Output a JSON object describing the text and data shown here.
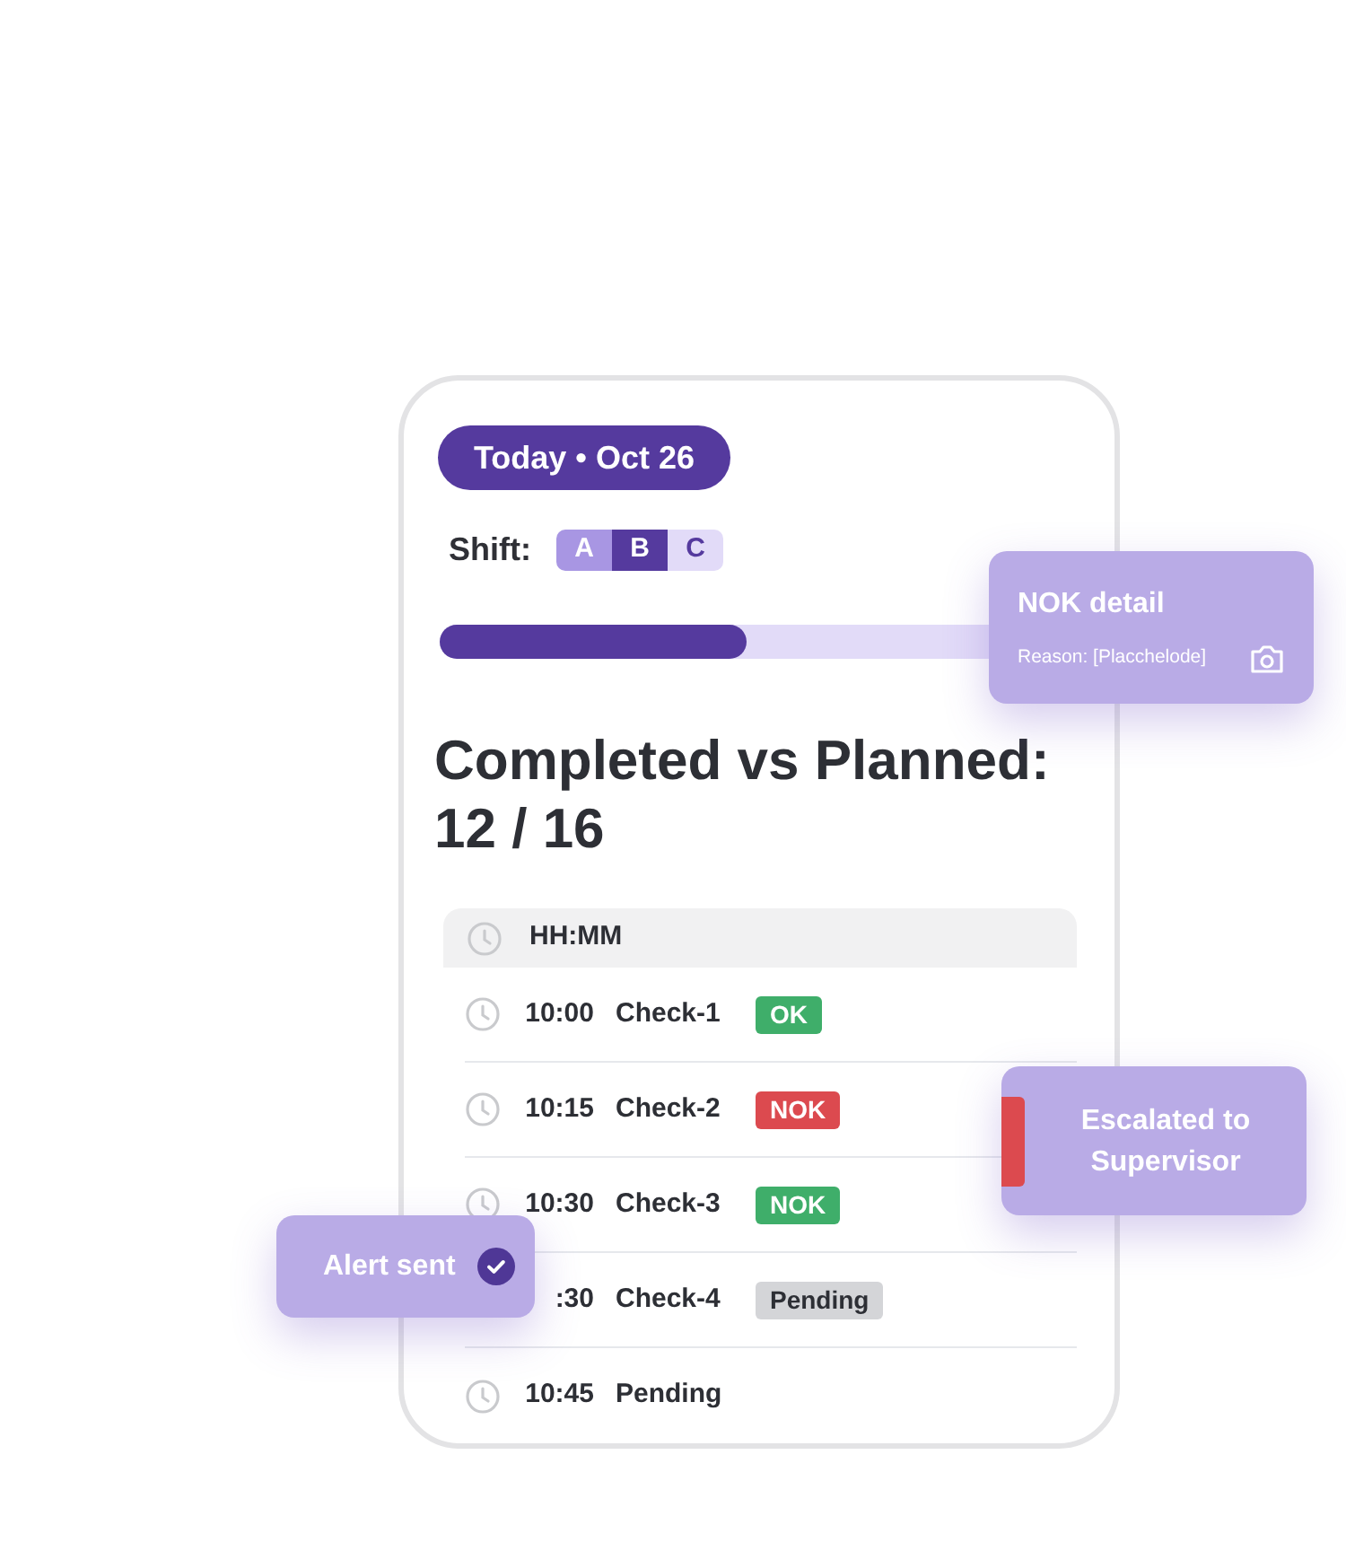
{
  "date_pill": "Today • Oct 26",
  "shift": {
    "label": "Shift:",
    "options": [
      {
        "label": "A",
        "selected": false
      },
      {
        "label": "B",
        "selected": true
      },
      {
        "label": "C",
        "selected": false
      }
    ]
  },
  "progress": {
    "level": 0.56
  },
  "heading": "Completed vs Planned:\n12 / 16",
  "list_header": "HH:MM",
  "rows": [
    {
      "clock": true,
      "time": "10:00",
      "name": "Check-1",
      "badge": {
        "text": "OK",
        "color": "#3fae6a"
      }
    },
    {
      "clock": true,
      "time": "10:15",
      "name": "Check-2",
      "badge": {
        "text": "NOK",
        "color": "#dc4a4f"
      }
    },
    {
      "clock": true,
      "time": "10:30",
      "name": "Check-3",
      "badge": {
        "text": "NOK",
        "color": "#3fae6a"
      }
    },
    {
      "clock": false,
      "time": ":30",
      "name": "Check-4",
      "badge": {
        "text": "Pending",
        "color": "#d4d5d8"
      }
    },
    {
      "clock": true,
      "time": "10:45",
      "name": "Pending"
    }
  ],
  "nok_detail": {
    "title": "NOK detail",
    "reason": "Reason: [Placchelode]"
  },
  "escalation": {
    "text": "Escalated to\nSupervisor"
  },
  "alert": {
    "text": "Alert sent",
    "checked": true
  }
}
